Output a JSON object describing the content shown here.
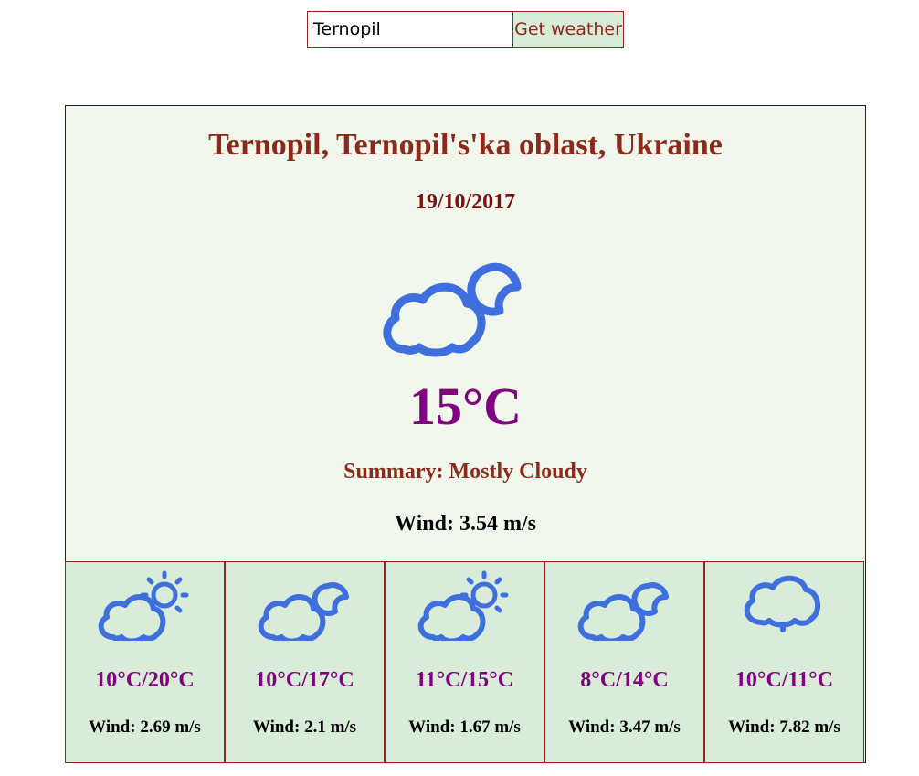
{
  "search": {
    "value": "Ternopil",
    "button_label": "Get weather"
  },
  "current": {
    "location": "Ternopil, Ternopil's'ka oblast, Ukraine",
    "date": "19/10/2017",
    "icon": "cloud-moon-icon",
    "temperature": "15°C",
    "summary_label": "Summary:",
    "summary_value": "Mostly Cloudy",
    "wind_label": "Wind:",
    "wind_value": "3.54 m/s"
  },
  "forecast": [
    {
      "icon": "cloud-sun-icon",
      "temperature": "10°C/20°C",
      "wind_label": "Wind:",
      "wind_value": "2.69 m/s"
    },
    {
      "icon": "cloud-moon-icon",
      "temperature": "10°C/17°C",
      "wind_label": "Wind:",
      "wind_value": "2.1 m/s"
    },
    {
      "icon": "cloud-sun-icon",
      "temperature": "11°C/15°C",
      "wind_label": "Wind:",
      "wind_value": "1.67 m/s"
    },
    {
      "icon": "cloud-moon-icon",
      "temperature": "8°C/14°C",
      "wind_label": "Wind:",
      "wind_value": "3.47 m/s"
    },
    {
      "icon": "cloud-drizzle-icon",
      "temperature": "10°C/11°C",
      "wind_label": "Wind:",
      "wind_value": "7.82 m/s"
    }
  ],
  "colors": {
    "accent": "#8b2a1a",
    "temperature": "#800080",
    "icon": "#3e6fdd",
    "card_background": "#f1f7ec",
    "forecast_background": "#d9ecda"
  }
}
